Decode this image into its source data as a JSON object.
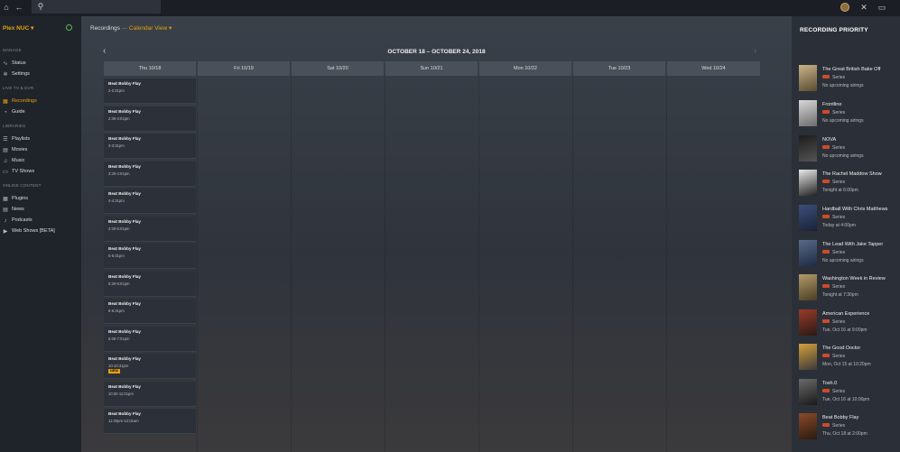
{
  "topbar": {
    "search_placeholder": "",
    "icons": [
      "home-icon",
      "back-icon",
      "search-icon",
      "avatar",
      "tools-icon",
      "cast-icon"
    ]
  },
  "sidebar": {
    "server_name": "Plex NUC ▾",
    "sections": {
      "manage": "MANAGE",
      "live_tv": "LIVE TV & DVR",
      "libraries": "LIBRARIES",
      "online": "ONLINE CONTENT"
    },
    "items": {
      "status": "Status",
      "settings": "Settings",
      "recordings": "Recordings",
      "guide": "Guide",
      "playlists": "Playlists",
      "movies": "Movies",
      "music": "Music",
      "tv_shows": "TV Shows",
      "plugins": "Plugins",
      "news": "News",
      "podcasts": "Podcasts",
      "web_shows": "Web Shows [BETA]"
    }
  },
  "main": {
    "breadcrumb": {
      "section": "Recordings",
      "sep": "—",
      "view": "Calendar View ▾"
    },
    "range": "OCTOBER 18 – OCTOBER 24, 2018",
    "days": [
      "Thu 10/18",
      "Fri 10/19",
      "Sat 10/20",
      "Sun 10/21",
      "Mon 10/22",
      "Tue 10/23",
      "Wed 10/24"
    ],
    "events": [
      {
        "title": "Beat Bobby Flay",
        "time": "2-2:31pm"
      },
      {
        "title": "Beat Bobby Flay",
        "time": "2:30-3:01pm"
      },
      {
        "title": "Beat Bobby Flay",
        "time": "3-3:31pm"
      },
      {
        "title": "Beat Bobby Flay",
        "time": "3:30-4:01pm"
      },
      {
        "title": "Beat Bobby Flay",
        "time": "4-4:31pm"
      },
      {
        "title": "Beat Bobby Flay",
        "time": "4:30-5:01pm"
      },
      {
        "title": "Beat Bobby Flay",
        "time": "5-5:31pm"
      },
      {
        "title": "Beat Bobby Flay",
        "time": "5:30-6:01pm"
      },
      {
        "title": "Beat Bobby Flay",
        "time": "6-6:31pm"
      },
      {
        "title": "Beat Bobby Flay",
        "time": "6:30-7:01pm"
      },
      {
        "title": "Beat Bobby Flay",
        "time": "10-10:31pm",
        "badge": "NEW"
      },
      {
        "title": "Beat Bobby Flay",
        "time": "10:30-11:01pm"
      },
      {
        "title": "Beat Bobby Flay",
        "time": "11:30pm-12:01am"
      }
    ]
  },
  "priority": {
    "heading": "RECORDING PRIORITY",
    "series_label": "Series",
    "items": [
      {
        "title": "The Great British Bake Off",
        "airing": "No upcoming airings"
      },
      {
        "title": "Frontline",
        "airing": "No upcoming airings"
      },
      {
        "title": "NOVA",
        "airing": "No upcoming airings"
      },
      {
        "title": "The Rachel Maddow Show",
        "airing": "Tonight at 6:00pm"
      },
      {
        "title": "Hardball With Chris Matthews",
        "airing": "Today at 4:00pm"
      },
      {
        "title": "The Lead With Jake Tapper",
        "airing": "No upcoming airings"
      },
      {
        "title": "Washington Week in Review",
        "airing": "Tonight at 7:30pm"
      },
      {
        "title": "American Experience",
        "airing": "Tue, Oct 16 at 9:00pm"
      },
      {
        "title": "The Good Doctor",
        "airing": "Mon, Oct 15 at 10:20pm"
      },
      {
        "title": "Tosh.0",
        "airing": "Tue, Oct 16 at 10:00pm"
      },
      {
        "title": "Beat Bobby Flay",
        "airing": "Thu, Oct 18 at 2:00pm"
      }
    ]
  },
  "colors": {
    "accent": "#e5a00d",
    "record_badge": "#cc4b2a",
    "status_ok": "#5db553"
  }
}
